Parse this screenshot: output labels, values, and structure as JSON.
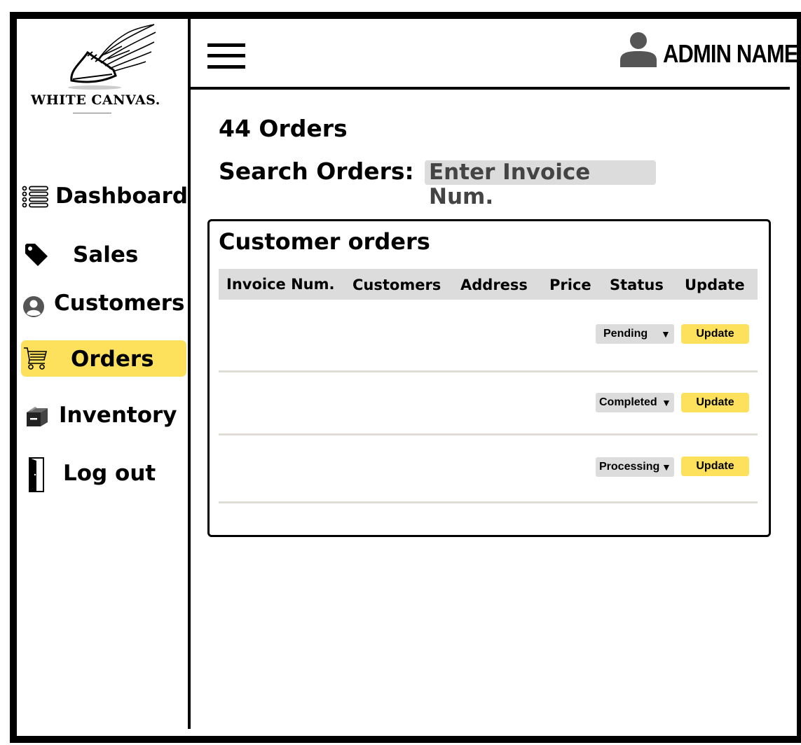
{
  "brand": {
    "name": "WHITE CANVAS."
  },
  "sidebar": {
    "items": [
      {
        "label": "Dashboard",
        "icon": "list-icon"
      },
      {
        "label": "Sales",
        "icon": "tag-icon"
      },
      {
        "label": "Customers",
        "icon": "user-circle-icon"
      },
      {
        "label": "Orders",
        "icon": "cart-icon",
        "active": true
      },
      {
        "label": "Inventory",
        "icon": "box-icon"
      },
      {
        "label": "Log out",
        "icon": "door-icon"
      }
    ]
  },
  "header": {
    "menu_icon": "hamburger-icon",
    "admin_icon": "user-icon",
    "admin_name": "ADMIN NAME"
  },
  "main": {
    "orders_count": "44 Orders",
    "search_label": "Search Orders:",
    "search_placeholder": "Enter Invoice Num."
  },
  "orders_table": {
    "title": "Customer orders",
    "columns": [
      "Invoice Num.",
      "Customers",
      "Address",
      "Price",
      "Status",
      "Update"
    ],
    "rows": [
      {
        "status": "Pending",
        "update_label": "Update"
      },
      {
        "status": "Completed",
        "update_label": "Update"
      },
      {
        "status": "Processing",
        "update_label": "Update"
      }
    ]
  },
  "colors": {
    "accent": "#fde05c",
    "header_bg": "#dcdcdc",
    "border": "#000000"
  }
}
